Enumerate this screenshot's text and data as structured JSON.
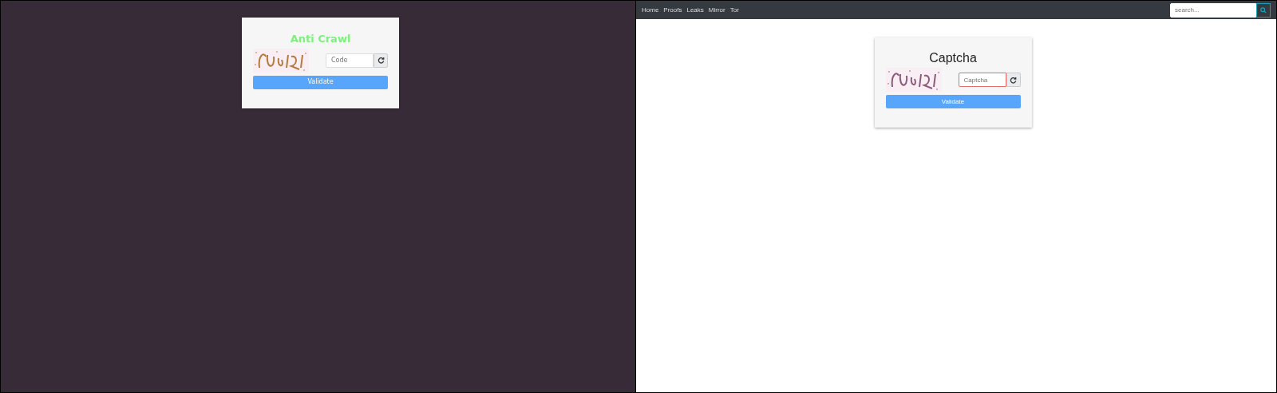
{
  "left_pane": {
    "card": {
      "title": "Anti Crawl",
      "field": {
        "placeholder": "Code",
        "invalid": false
      },
      "button": "Validate"
    }
  },
  "right_pane": {
    "navbar": {
      "links": [
        {
          "label": "Home"
        },
        {
          "label": "Proofs"
        },
        {
          "label": "Leaks"
        },
        {
          "label": "Mirror"
        },
        {
          "label": "Tor"
        }
      ],
      "search": {
        "placeholder": "search..."
      }
    },
    "card": {
      "title": "Captcha",
      "field": {
        "placeholder": "Captcha",
        "invalid": true
      },
      "button": "Validate"
    }
  }
}
